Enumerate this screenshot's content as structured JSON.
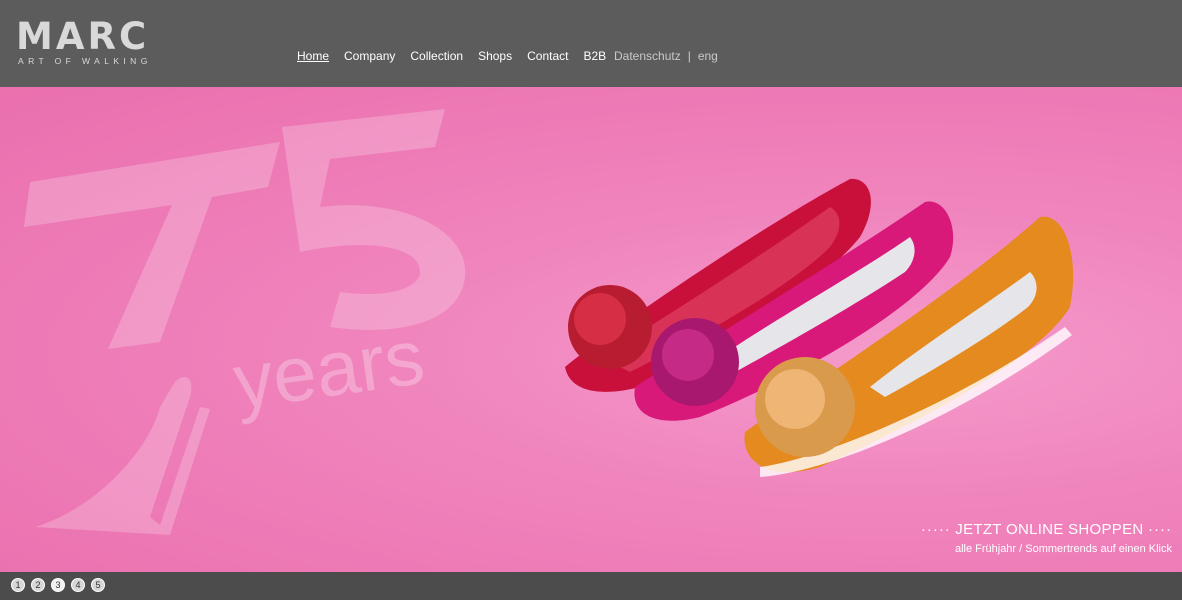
{
  "brand": {
    "name": "MARC",
    "tagline": "ART OF WALKING"
  },
  "nav": {
    "items": [
      {
        "label": "Home",
        "active": true
      },
      {
        "label": "Company",
        "active": false
      },
      {
        "label": "Collection",
        "active": false
      },
      {
        "label": "Shops",
        "active": false
      },
      {
        "label": "Contact",
        "active": false
      },
      {
        "label": "B2B",
        "active": false
      }
    ]
  },
  "meta_links": {
    "privacy": "Datenschutz",
    "separator": "|",
    "language": "eng"
  },
  "hero": {
    "anniversary_number": "75",
    "anniversary_word": "years",
    "promo_dots": "·····",
    "promo_title": "JETZT ONLINE SHOPPEN",
    "promo_title_dots": "····",
    "promo_subtitle": "alle Frühjahr / Sommertrends auf einen Klick",
    "background_color": "#f084bd"
  },
  "pager": {
    "pages": [
      "1",
      "2",
      "3",
      "4",
      "5"
    ],
    "current": "3"
  },
  "colors": {
    "header_bg": "#5c5c5c",
    "footer_bg": "#4c4c4c",
    "nav_text": "#ffffff",
    "meta_text": "#c9c9c9"
  }
}
